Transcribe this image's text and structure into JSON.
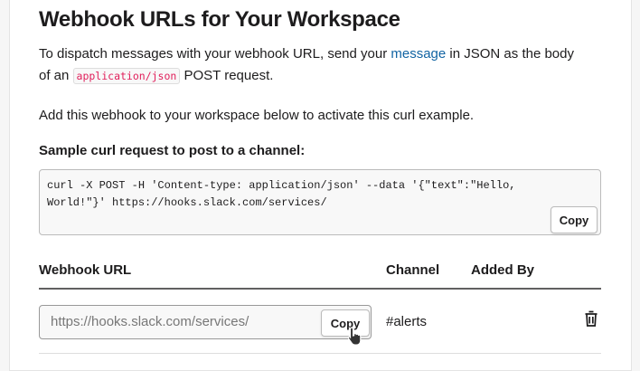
{
  "title": "Webhook URLs for Your Workspace",
  "intro": {
    "before": "To dispatch messages with your webhook URL, send your ",
    "link": "message",
    "after": " in JSON as the body",
    "line2_before": "of an ",
    "code": "application/json",
    "line2_after": " POST request."
  },
  "activate_text": "Add this webhook to your workspace below to activate this curl example.",
  "sample_label": "Sample curl request to post to a channel:",
  "curl": {
    "line1": "curl -X POST -H 'Content-type: application/json' --data '{\"text\":\"Hello,",
    "line2": "World!\"}' https://hooks.slack.com/services/",
    "copy_label": "Copy"
  },
  "table": {
    "headers": [
      "Webhook URL",
      "Channel",
      "Added By"
    ],
    "rows": [
      {
        "url": "https://hooks.slack.com/services/",
        "copy_label": "Copy",
        "channel": "#alerts",
        "added_by": ""
      }
    ]
  },
  "icons": {
    "delete": "trash-icon",
    "cursor": "hand-pointer-icon"
  }
}
